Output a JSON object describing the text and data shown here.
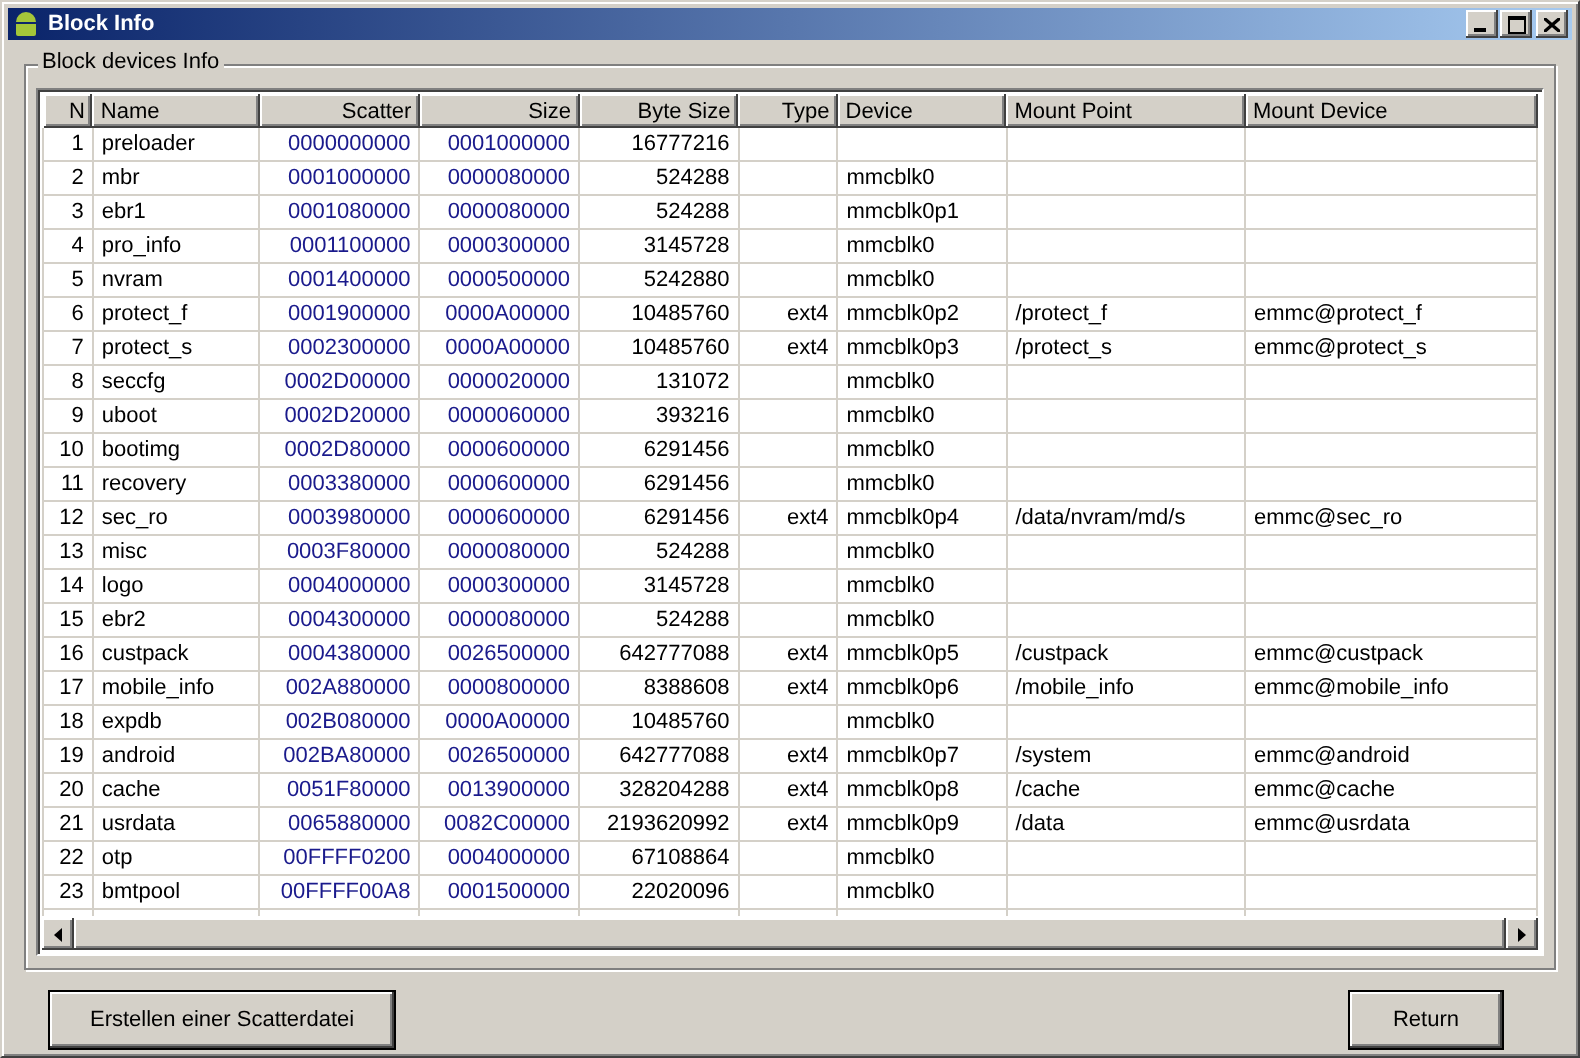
{
  "window": {
    "title": "Block Info"
  },
  "group": {
    "title": "Block devices Info"
  },
  "table": {
    "columns": [
      "N",
      "Name",
      "Scatter",
      "Size",
      "Byte Size",
      "Type",
      "Device",
      "Mount Point",
      "Mount Device"
    ],
    "rows": [
      {
        "n": "1",
        "name": "preloader",
        "scatter": "0000000000",
        "size": "0001000000",
        "byte_size": "16777216"
      },
      {
        "n": "2",
        "name": "mbr",
        "scatter": "0001000000",
        "size": "0000080000",
        "byte_size": "524288",
        "device": "mmcblk0"
      },
      {
        "n": "3",
        "name": "ebr1",
        "scatter": "0001080000",
        "size": "0000080000",
        "byte_size": "524288",
        "device": "mmcblk0p1"
      },
      {
        "n": "4",
        "name": "pro_info",
        "scatter": "0001100000",
        "size": "0000300000",
        "byte_size": "3145728",
        "device": "mmcblk0"
      },
      {
        "n": "5",
        "name": "nvram",
        "scatter": "0001400000",
        "size": "0000500000",
        "byte_size": "5242880",
        "device": "mmcblk0"
      },
      {
        "n": "6",
        "name": "protect_f",
        "scatter": "0001900000",
        "size": "0000A00000",
        "byte_size": "10485760",
        "type": "ext4",
        "device": "mmcblk0p2",
        "mount_point": "/protect_f",
        "mount_device": "emmc@protect_f"
      },
      {
        "n": "7",
        "name": "protect_s",
        "scatter": "0002300000",
        "size": "0000A00000",
        "byte_size": "10485760",
        "type": "ext4",
        "device": "mmcblk0p3",
        "mount_point": "/protect_s",
        "mount_device": "emmc@protect_s"
      },
      {
        "n": "8",
        "name": "seccfg",
        "scatter": "0002D00000",
        "size": "0000020000",
        "byte_size": "131072",
        "device": "mmcblk0"
      },
      {
        "n": "9",
        "name": "uboot",
        "scatter": "0002D20000",
        "size": "0000060000",
        "byte_size": "393216",
        "device": "mmcblk0"
      },
      {
        "n": "10",
        "name": "bootimg",
        "scatter": "0002D80000",
        "size": "0000600000",
        "byte_size": "6291456",
        "device": "mmcblk0"
      },
      {
        "n": "11",
        "name": "recovery",
        "scatter": "0003380000",
        "size": "0000600000",
        "byte_size": "6291456",
        "device": "mmcblk0"
      },
      {
        "n": "12",
        "name": "sec_ro",
        "scatter": "0003980000",
        "size": "0000600000",
        "byte_size": "6291456",
        "type": "ext4",
        "device": "mmcblk0p4",
        "mount_point": "/data/nvram/md/s",
        "mount_device": "emmc@sec_ro"
      },
      {
        "n": "13",
        "name": "misc",
        "scatter": "0003F80000",
        "size": "0000080000",
        "byte_size": "524288",
        "device": "mmcblk0"
      },
      {
        "n": "14",
        "name": "logo",
        "scatter": "0004000000",
        "size": "0000300000",
        "byte_size": "3145728",
        "device": "mmcblk0"
      },
      {
        "n": "15",
        "name": "ebr2",
        "scatter": "0004300000",
        "size": "0000080000",
        "byte_size": "524288",
        "device": "mmcblk0"
      },
      {
        "n": "16",
        "name": "custpack",
        "scatter": "0004380000",
        "size": "0026500000",
        "byte_size": "642777088",
        "type": "ext4",
        "device": "mmcblk0p5",
        "mount_point": "/custpack",
        "mount_device": "emmc@custpack"
      },
      {
        "n": "17",
        "name": "mobile_info",
        "scatter": "002A880000",
        "size": "0000800000",
        "byte_size": "8388608",
        "type": "ext4",
        "device": "mmcblk0p6",
        "mount_point": "/mobile_info",
        "mount_device": "emmc@mobile_info"
      },
      {
        "n": "18",
        "name": "expdb",
        "scatter": "002B080000",
        "size": "0000A00000",
        "byte_size": "10485760",
        "device": "mmcblk0"
      },
      {
        "n": "19",
        "name": "android",
        "scatter": "002BA80000",
        "size": "0026500000",
        "byte_size": "642777088",
        "type": "ext4",
        "device": "mmcblk0p7",
        "mount_point": "/system",
        "mount_device": "emmc@android"
      },
      {
        "n": "20",
        "name": "cache",
        "scatter": "0051F80000",
        "size": "0013900000",
        "byte_size": "328204288",
        "type": "ext4",
        "device": "mmcblk0p8",
        "mount_point": "/cache",
        "mount_device": "emmc@cache"
      },
      {
        "n": "21",
        "name": "usrdata",
        "scatter": "0065880000",
        "size": "0082C00000",
        "byte_size": "2193620992",
        "type": "ext4",
        "device": "mmcblk0p9",
        "mount_point": "/data",
        "mount_device": "emmc@usrdata"
      },
      {
        "n": "22",
        "name": "otp",
        "scatter": "00FFFF0200",
        "size": "0004000000",
        "byte_size": "67108864",
        "device": "mmcblk0"
      },
      {
        "n": "23",
        "name": "bmtpool",
        "scatter": "00FFFF00A8",
        "size": "0001500000",
        "byte_size": "22020096",
        "device": "mmcblk0"
      }
    ]
  },
  "buttons": [
    "Erstellen einer Scatterdatei",
    "Return"
  ]
}
